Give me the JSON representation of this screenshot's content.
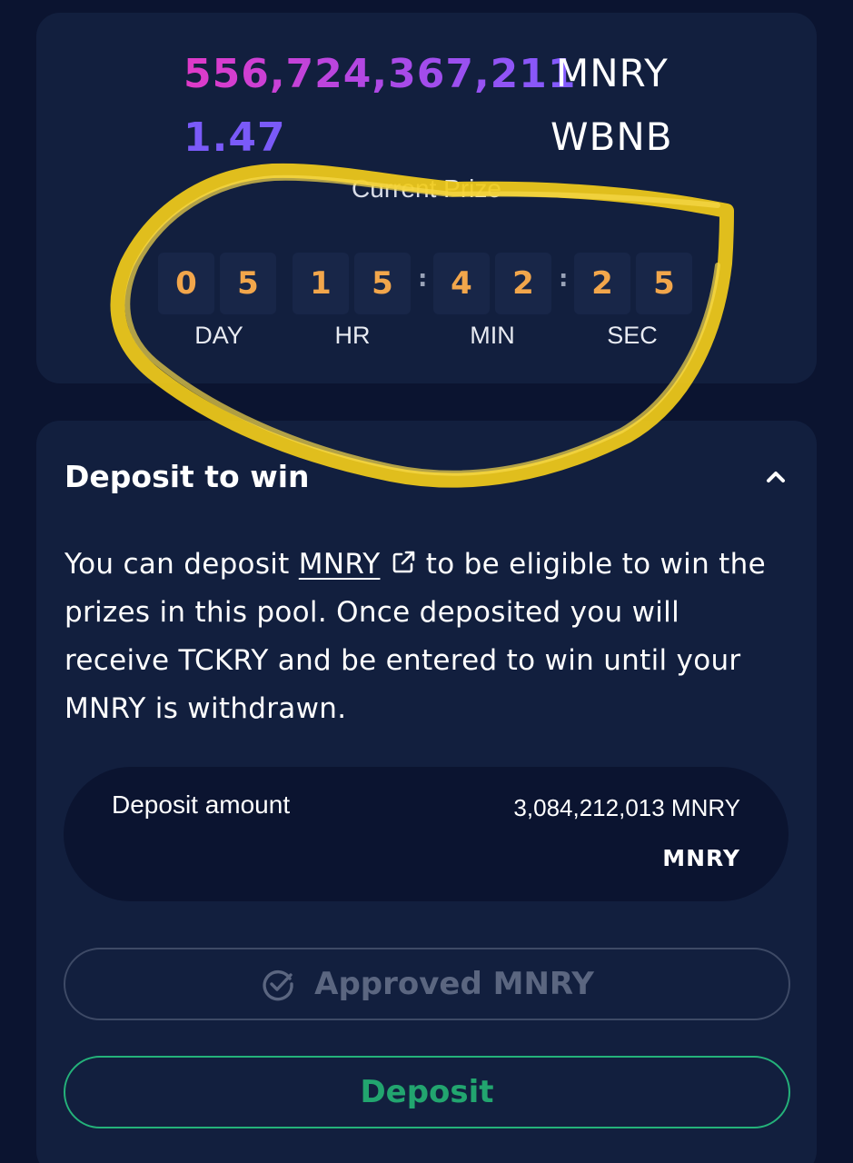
{
  "prize": {
    "mnry_amount": "556,724,367,211",
    "mnry_token": "MNRY",
    "wbnb_amount": "1.47",
    "wbnb_token": "WBNB",
    "label": "Current Prize",
    "countdown": {
      "day": [
        "0",
        "5"
      ],
      "hr": [
        "1",
        "5"
      ],
      "min": [
        "4",
        "2"
      ],
      "sec": [
        "2",
        "5"
      ],
      "units": [
        "DAY",
        "HR",
        "MIN",
        "SEC"
      ],
      "separator": ":"
    },
    "annotation_color": "#f2cc1a"
  },
  "deposit": {
    "title": "Deposit to win",
    "collapse_icon": "chevron-up-icon",
    "description": {
      "before_link": "You can deposit ",
      "link_text": "MNRY",
      "link_icon": "external-link-icon",
      "after_link": " to be eligible to win the prizes in this pool. Once deposited you will receive TCKRY and be entered to win until your MNRY is withdrawn."
    },
    "amount_label": "Deposit amount",
    "amount_value": "3,084,212,013 MNRY",
    "amount_token": "MNRY",
    "approved_label": "Approved MNRY",
    "approved_icon": "check-circle-icon",
    "deposit_label": "Deposit"
  },
  "colors": {
    "background": "#0b1430",
    "card": "#121f3e",
    "countdown_digit": "#f2a64b",
    "deposit_green": "#22a56f",
    "disabled_gray": "#5b6680",
    "wbnb_purple": "#7a5af8"
  }
}
